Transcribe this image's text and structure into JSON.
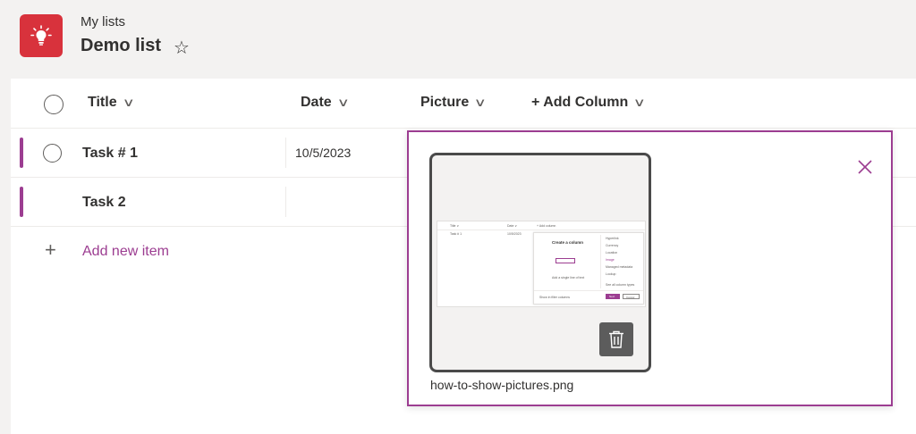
{
  "header": {
    "breadcrumb": "My lists",
    "title": "Demo list",
    "star_glyph": "☆"
  },
  "columns": [
    {
      "label": "Title",
      "chevron": "∨"
    },
    {
      "label": "Date",
      "chevron": "∨"
    },
    {
      "label": "Picture",
      "chevron": "∨"
    },
    {
      "label": "+ Add Column",
      "chevron": "∨"
    }
  ],
  "rows": [
    {
      "title": "Task # 1",
      "date": "10/5/2023"
    },
    {
      "title": "Task 2",
      "date": ""
    }
  ],
  "add_item": {
    "plus": "+",
    "label": "Add new item"
  },
  "picture_popup": {
    "filename": "how-to-show-pictures.png",
    "thumbnail": {
      "col_title": "Title ∨",
      "col_date": "Date ∨",
      "col_add": "+ Add column",
      "row_task": "Task # 1",
      "row_date": "10/5/2023",
      "panel_title": "Create a column",
      "panel_hint": "Add a single line of text",
      "options": [
        "Hyperlink",
        "Currency",
        "Location",
        "Image",
        "Managed metadata",
        "Lookup",
        "See all column types"
      ],
      "footer_check": "Show in filter columns",
      "next_button": "Next",
      "cancel_button": "Cancel"
    }
  },
  "colors": {
    "accent": "#9c3d91",
    "app_icon": "#d8323c",
    "page_bg": "#f3f2f1"
  },
  "icons": {
    "app": "lightbulb-icon",
    "favorite": "star-outline-icon",
    "close": "close-icon",
    "delete": "trash-icon"
  }
}
